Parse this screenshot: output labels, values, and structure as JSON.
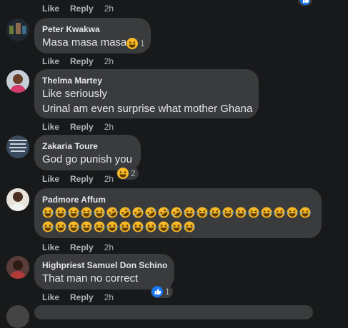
{
  "actions": {
    "like": "Like",
    "reply": "Reply"
  },
  "comments": [
    {
      "time": "2h"
    },
    {
      "name": "Peter Kwakwa",
      "lines": [
        "Masa masa masa"
      ],
      "reaction_count": "1",
      "time": "2h"
    },
    {
      "name": "Thelma Martey",
      "lines": [
        "Like seriously",
        "Urinal am even surprise what mother Ghana"
      ],
      "time": "2h"
    },
    {
      "name": "Zakaria Toure",
      "lines": [
        "God go punish you"
      ],
      "reaction_count": "2",
      "time": "2h"
    },
    {
      "name": "Padmore Affum",
      "emoji_rows": [
        [
          "laugh",
          "laugh",
          "laugh",
          "laugh",
          "laugh",
          "rofl",
          "rofl",
          "rofl",
          "rofl",
          "rofl",
          "rofl",
          "laugh",
          "laugh",
          "laugh",
          "laugh",
          "laugh",
          "laugh",
          "laugh",
          "laugh",
          "laugh",
          "laugh"
        ],
        [
          "laugh",
          "laugh",
          "laugh",
          "laugh",
          "laugh",
          "laugh",
          "laugh",
          "laugh",
          "laugh",
          "laugh",
          "laugh",
          "laugh"
        ]
      ],
      "time": "2h"
    },
    {
      "name": "Highpriest Samuel Don Schino",
      "lines": [
        "That man no correct"
      ],
      "reaction_count": "1",
      "time": "2h"
    }
  ],
  "colors": {
    "background": "#18191a",
    "bubble": "#3a3b3c",
    "text": "#e4e6eb",
    "muted": "#b0b3b8",
    "like_blue": "#1877f2",
    "emoji_yellow": "#f7b928"
  }
}
